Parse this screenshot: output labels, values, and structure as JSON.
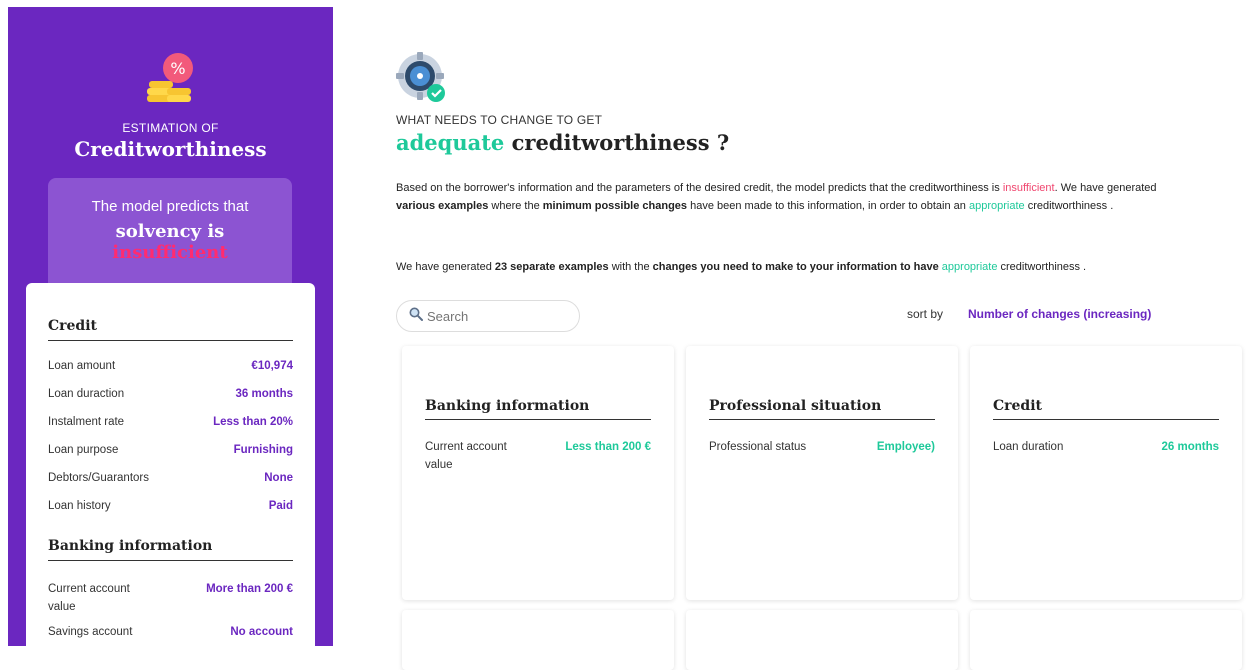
{
  "sidebar": {
    "estimation_label": "ESTIMATION OF",
    "estimation_title": "Creditworthiness",
    "prediction": {
      "line1": "The model predicts that",
      "line2": "solvency is",
      "line3": "insufficient"
    },
    "credit": {
      "title": "Credit",
      "rows": [
        {
          "label": "Loan amount",
          "value": "€10,974"
        },
        {
          "label": "Loan duraction",
          "value": "36 months"
        },
        {
          "label": "Instalment rate",
          "value": "Less than 20%"
        },
        {
          "label": "Loan purpose",
          "value": "Furnishing"
        },
        {
          "label": "Debtors/Guarantors",
          "value": "None"
        },
        {
          "label": "Loan history",
          "value": "Paid"
        }
      ]
    },
    "banking": {
      "title": "Banking information",
      "rows": [
        {
          "label": "Current account value",
          "value": "More than 200 €"
        },
        {
          "label": "Savings account",
          "value": "No account"
        }
      ]
    }
  },
  "main": {
    "eyebrow": "WHAT NEEDS TO CHANGE TO GET",
    "heading_green": "adequate",
    "heading_rest": "creditworthiness ?",
    "para1": {
      "t1": "Based on the borrower's information and the parameters of the desired credit, the model predicts that the creditworthiness is",
      "t2": "insufficient",
      "t3": ". We have generated",
      "t4": "various examples",
      "t5": "where the",
      "t6": "minimum possible changes",
      "t7": "have been made to this information, in order to obtain an",
      "t8": "appropriate",
      "t9": "creditworthiness ."
    },
    "para2": {
      "t1": "We have generated",
      "t2": "23 separate examples",
      "t3": "with the",
      "t4": "changes you need to make to your information to have",
      "t5": "appropriate",
      "t6": "creditworthiness ."
    },
    "search": {
      "placeholder": "Search",
      "value": ""
    },
    "sort_label": "sort by",
    "sort_value": "Number of changes (increasing)",
    "cards": [
      {
        "title": "Banking information",
        "label": "Current account value",
        "value": "Less than 200 €"
      },
      {
        "title": "Professional situation",
        "label": "Professional status",
        "value": "Employee)"
      },
      {
        "title": "Credit",
        "label": "Loan duration",
        "value": "26 months"
      }
    ]
  },
  "icons": {
    "logo": "coins-percent-icon",
    "gear": "gear-check-icon",
    "search": "magnifier-icon"
  },
  "colors": {
    "purple": "#6b27c0",
    "green": "#1ec99a",
    "pink": "#f0466f",
    "insufficient_red": "#ff2b70"
  }
}
